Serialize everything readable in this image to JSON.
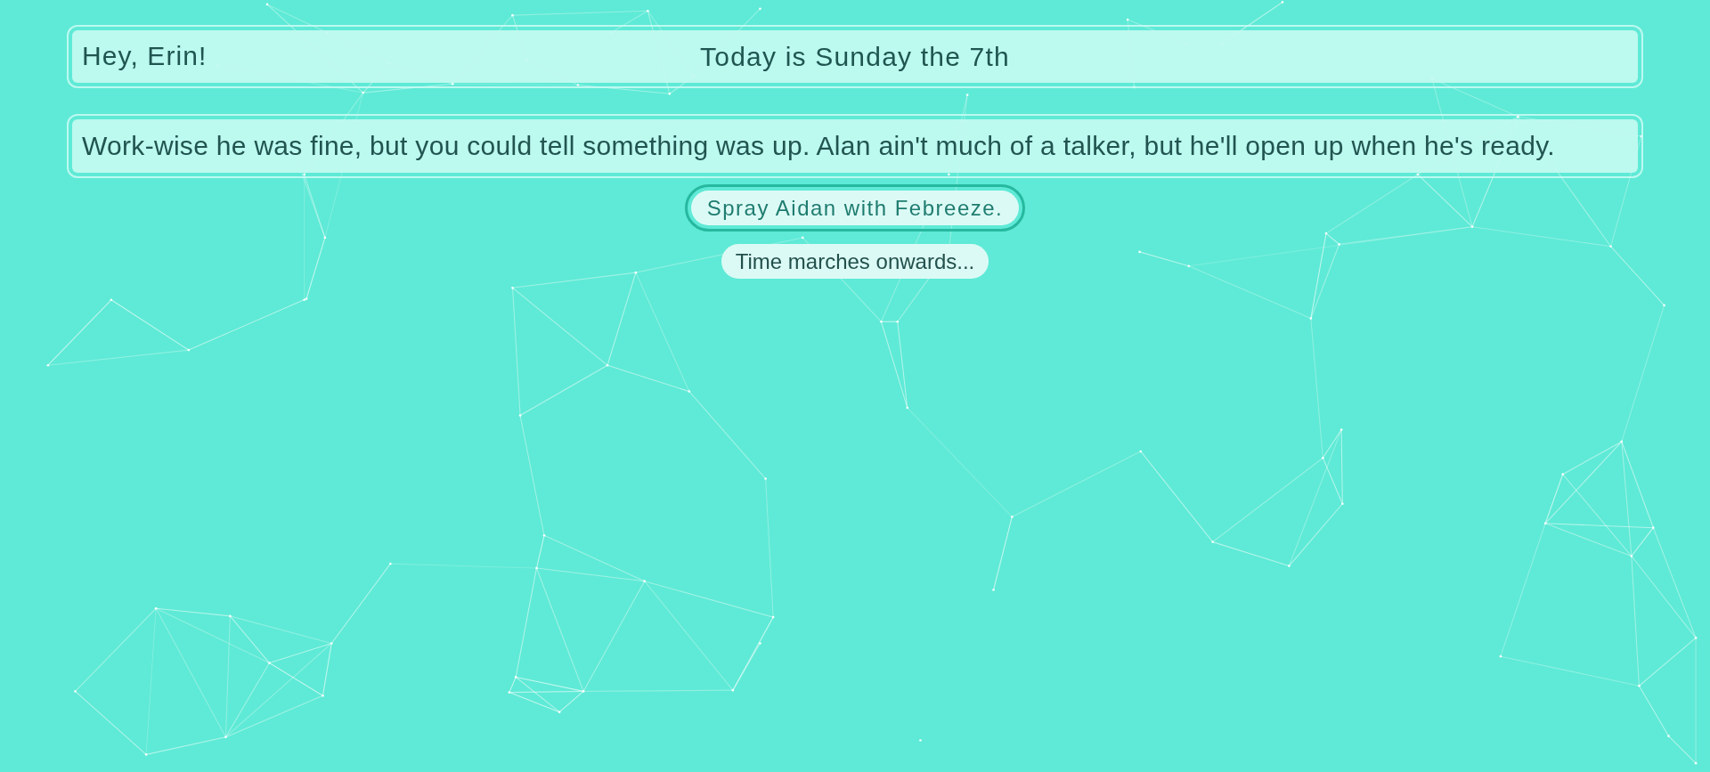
{
  "header": {
    "greeting": "Hey, Erin!",
    "date": "Today is Sunday the 7th"
  },
  "message": {
    "text": "Work-wise he was fine, but you could tell something was up. Alan ain't much of a talker, but he'll open up when he's ready."
  },
  "choices": [
    {
      "label": "Spray Aidan with Febreeze.",
      "focused": true
    },
    {
      "label": "Time marches onwards...",
      "focused": false
    }
  ]
}
